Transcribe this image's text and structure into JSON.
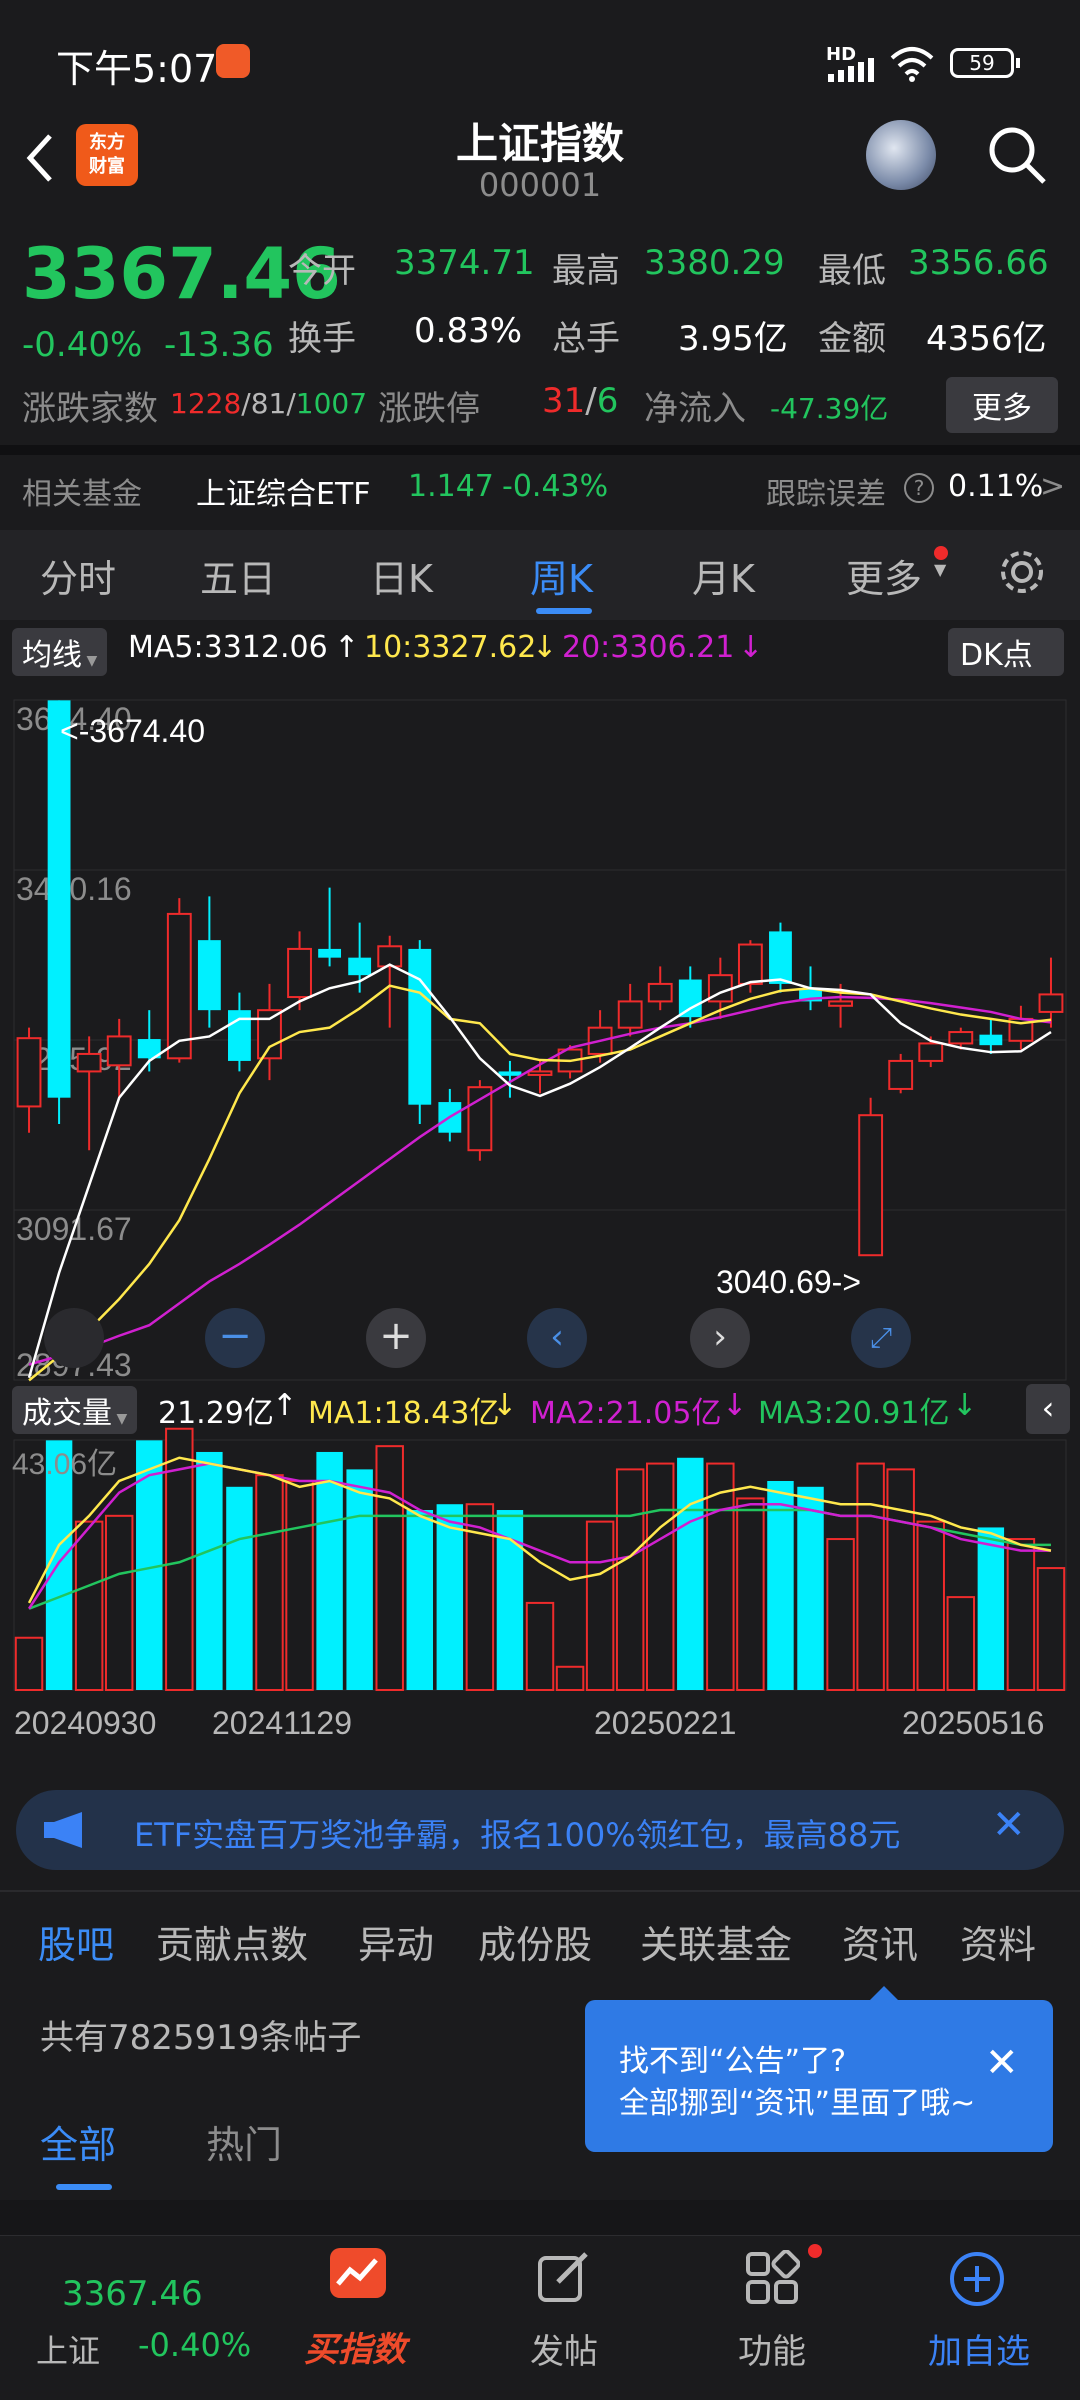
{
  "status": {
    "time": "下午5:07",
    "network": "HD",
    "battery": "59"
  },
  "header": {
    "title": "上证指数",
    "code": "000001"
  },
  "quote": {
    "price": "3367.46",
    "change_pct": "-0.40%",
    "change_abs": "-13.36",
    "open_label": "今开",
    "open": "3374.71",
    "high_label": "最高",
    "high": "3380.29",
    "low_label": "最低",
    "low": "3356.66",
    "turnover_label": "换手",
    "turnover": "0.83%",
    "volume_label": "总手",
    "volume": "3.95亿",
    "amount_label": "金额",
    "amount": "4356亿",
    "breadth_label": "涨跌家数",
    "up": "1228",
    "flat": "81",
    "down": "1007",
    "limit_label": "涨跌停",
    "limit_up": "31",
    "limit_down": "6",
    "inflow_label": "净流入",
    "inflow": "-47.39亿",
    "more_label": "更多"
  },
  "fund": {
    "label": "相关基金",
    "name": "上证综合ETF",
    "price": "1.147",
    "change": "-0.43%",
    "tracking_label": "跟踪误差",
    "tracking": "0.11%"
  },
  "period_tabs": [
    "分时",
    "五日",
    "日K",
    "周K",
    "月K",
    "更多"
  ],
  "ma": {
    "selector": "均线",
    "ma5": "MA5:3312.06",
    "ma10": "10:3327.62",
    "ma20": "20:3306.21",
    "dk": "DK点"
  },
  "price_axis": [
    "3674.40",
    "3480.16",
    "3285.92",
    "3091.67",
    "2897.43"
  ],
  "price_annot": {
    "high": "<-3674.40",
    "low": "3040.69->"
  },
  "vol": {
    "selector": "成交量",
    "value": "21.29亿",
    "ma1": "MA1:18.43亿",
    "ma2": "MA2:21.05亿",
    "ma3": "MA3:20.91亿",
    "axis_top": "43.06亿"
  },
  "dates": [
    "20240930",
    "20241129",
    "20250221",
    "20250516"
  ],
  "notice": "ETF实盘百万奖池争霸，报名100%领红包，最高88元",
  "bottom_tabs": [
    "股吧",
    "贡献点数",
    "异动",
    "成份股",
    "关联基金",
    "资讯",
    "资料"
  ],
  "posts": {
    "count": "共有7825919条帖子",
    "filter_all": "全部",
    "filter_hot": "热门"
  },
  "tooltip": {
    "line1": "找不到“公告”了?",
    "line2": "全部挪到“资讯”里面了哦~"
  },
  "bottom_nav": {
    "index_price": "3367.46",
    "index_name": "上证",
    "index_change": "-0.40%",
    "buy": "买指数",
    "post": "发帖",
    "function": "功能",
    "add": "加自选"
  },
  "colors": {
    "up": "#ef2b2b",
    "down": "#22c55e",
    "cyan": "#00f0ff",
    "ma5": "#ffffff",
    "ma10": "#ffe84d",
    "ma20": "#d020d0",
    "accent": "#3b82f6"
  },
  "chart_data": {
    "type": "candlestick",
    "ylim": [
      2897.43,
      3674.4
    ],
    "candles": [
      {
        "o": 3210,
        "c": 3288,
        "h": 3300,
        "l": 3180
      },
      {
        "o": 3674,
        "c": 3220,
        "h": 3674,
        "l": 3190
      },
      {
        "o": 3250,
        "c": 3270,
        "h": 3290,
        "l": 3160
      },
      {
        "o": 3257,
        "c": 3290,
        "h": 3310,
        "l": 3220
      },
      {
        "o": 3287,
        "c": 3265,
        "h": 3320,
        "l": 3250
      },
      {
        "o": 3265,
        "c": 3430,
        "h": 3448,
        "l": 3260
      },
      {
        "o": 3400,
        "c": 3320,
        "h": 3450,
        "l": 3300
      },
      {
        "o": 3320,
        "c": 3262,
        "h": 3340,
        "l": 3250
      },
      {
        "o": 3265,
        "c": 3320,
        "h": 3350,
        "l": 3240
      },
      {
        "o": 3335,
        "c": 3390,
        "h": 3410,
        "l": 3320
      },
      {
        "o": 3390,
        "c": 3380,
        "h": 3460,
        "l": 3370
      },
      {
        "o": 3380,
        "c": 3360,
        "h": 3420,
        "l": 3340
      },
      {
        "o": 3370,
        "c": 3393,
        "h": 3405,
        "l": 3300
      },
      {
        "o": 3390,
        "c": 3212,
        "h": 3400,
        "l": 3190
      },
      {
        "o": 3215,
        "c": 3180,
        "h": 3230,
        "l": 3170
      },
      {
        "o": 3160,
        "c": 3232,
        "h": 3240,
        "l": 3148
      },
      {
        "o": 3250,
        "c": 3245,
        "h": 3262,
        "l": 3220
      },
      {
        "o": 3246,
        "c": 3250,
        "h": 3262,
        "l": 3225
      },
      {
        "o": 3250,
        "c": 3275,
        "h": 3280,
        "l": 3242
      },
      {
        "o": 3270,
        "c": 3300,
        "h": 3320,
        "l": 3260
      },
      {
        "o": 3300,
        "c": 3330,
        "h": 3350,
        "l": 3290
      },
      {
        "o": 3330,
        "c": 3350,
        "h": 3370,
        "l": 3320
      },
      {
        "o": 3355,
        "c": 3312,
        "h": 3370,
        "l": 3300
      },
      {
        "o": 3330,
        "c": 3360,
        "h": 3380,
        "l": 3310
      },
      {
        "o": 3350,
        "c": 3395,
        "h": 3400,
        "l": 3340
      },
      {
        "o": 3410,
        "c": 3350,
        "h": 3420,
        "l": 3340
      },
      {
        "o": 3345,
        "c": 3330,
        "h": 3370,
        "l": 3320
      },
      {
        "o": 3325,
        "c": 3330,
        "h": 3350,
        "l": 3300
      },
      {
        "o": 3040,
        "c": 3200,
        "h": 3220,
        "l": 3040
      },
      {
        "o": 3230,
        "c": 3262,
        "h": 3270,
        "l": 3225
      },
      {
        "o": 3262,
        "c": 3282,
        "h": 3290,
        "l": 3255
      },
      {
        "o": 3282,
        "c": 3295,
        "h": 3300,
        "l": 3275
      },
      {
        "o": 3292,
        "c": 3280,
        "h": 3310,
        "l": 3270
      },
      {
        "o": 3285,
        "c": 3310,
        "h": 3325,
        "l": 3275
      },
      {
        "o": 3318,
        "c": 3338,
        "h": 3380,
        "l": 3300
      }
    ],
    "ma5": [
      2900,
      3020,
      3120,
      3220,
      3262,
      3285,
      3290,
      3310,
      3310,
      3330,
      3345,
      3353,
      3372,
      3355,
      3312,
      3265,
      3234,
      3222,
      3236,
      3255,
      3277,
      3300,
      3322,
      3340,
      3352,
      3355,
      3345,
      3343,
      3338,
      3305,
      3285,
      3277,
      3272,
      3273,
      3295
    ],
    "ma10": [
      2897,
      2925,
      2955,
      2990,
      3030,
      3080,
      3150,
      3225,
      3278,
      3295,
      3300,
      3322,
      3348,
      3340,
      3310,
      3305,
      3270,
      3263,
      3262,
      3268,
      3275,
      3290,
      3305,
      3320,
      3333,
      3342,
      3345,
      3340,
      3338,
      3330,
      3322,
      3315,
      3310,
      3305,
      3309
    ],
    "ma20": [
      2915,
      2925,
      2935,
      2948,
      2960,
      2985,
      3010,
      3030,
      3052,
      3075,
      3100,
      3125,
      3150,
      3175,
      3198,
      3218,
      3238,
      3258,
      3277,
      3285,
      3293,
      3300,
      3305,
      3312,
      3320,
      3328,
      3333,
      3335,
      3334,
      3332,
      3328,
      3323,
      3318,
      3310,
      3306
    ],
    "volume": [
      9,
      43,
      29,
      30,
      43,
      45,
      41,
      35,
      37,
      36,
      41,
      38,
      42,
      31,
      32,
      32,
      31,
      15,
      4,
      29,
      38,
      39,
      40,
      39,
      33,
      36,
      35,
      26,
      39,
      38,
      29,
      16,
      28,
      26,
      21
    ],
    "vol_ma1": [
      15,
      25,
      30,
      36,
      38,
      40,
      39,
      38,
      37,
      35,
      36,
      34,
      33,
      30,
      28,
      27,
      26,
      22,
      19,
      20,
      23,
      28,
      32,
      34,
      35,
      34,
      33,
      32,
      32,
      31,
      30,
      28,
      27,
      25,
      24
    ],
    "vol_ma2": [
      14,
      22,
      28,
      34,
      37,
      38,
      39,
      38,
      37,
      36,
      36,
      35,
      34,
      31,
      29,
      28,
      26,
      24,
      22,
      22,
      23,
      26,
      29,
      31,
      32,
      32,
      31,
      30,
      30,
      29,
      28,
      26,
      25,
      24,
      24
    ],
    "vol_ma3": [
      14,
      16,
      18,
      20,
      21,
      22,
      24,
      26,
      27,
      28,
      29,
      30,
      30,
      30,
      30,
      30,
      30,
      30,
      30,
      30,
      30,
      31,
      31,
      31,
      31,
      31,
      31,
      30,
      30,
      29,
      28,
      27,
      26,
      25,
      25
    ]
  }
}
